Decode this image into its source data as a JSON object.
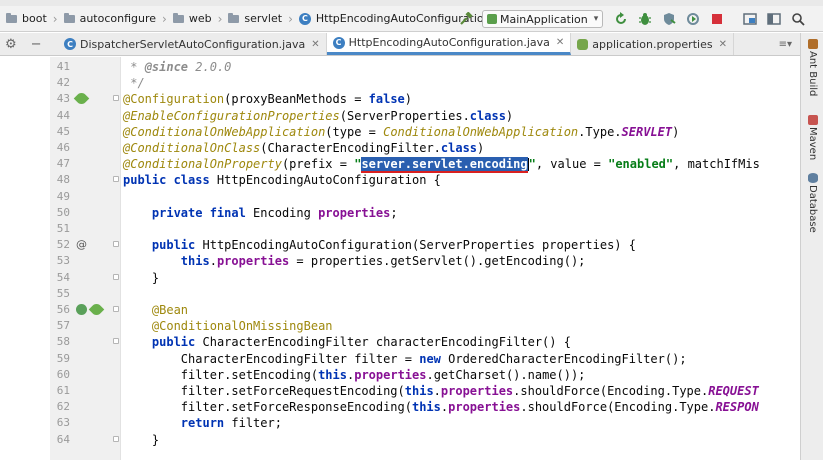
{
  "breadcrumbs": [
    "boot",
    "autoconfigure",
    "web",
    "servlet",
    "HttpEncodingAutoConfiguration"
  ],
  "run_config": "MainApplication",
  "tabs": [
    {
      "label": "DispatcherServletAutoConfiguration.java",
      "active": false,
      "icon": "class-icon"
    },
    {
      "label": "HttpEncodingAutoConfiguration.java",
      "active": true,
      "icon": "class-icon"
    },
    {
      "label": "application.properties",
      "active": false,
      "icon": "properties-icon"
    }
  ],
  "tab_menu_label": "≡",
  "right_tools": [
    "Ant Build",
    "Maven",
    "Database"
  ],
  "colors": {
    "keyword": "#0033b3",
    "annotation": "#9e880d",
    "string": "#067d17",
    "field": "#871094",
    "selection": "#2a5fb0",
    "accent": "#4a88c7"
  },
  "lines": [
    {
      "n": "41",
      "html": " <span class=\"cmt\">* </span><span class=\"doctag\">@since</span><span class=\"cmt\"> 2.0.0</span>",
      "marks": []
    },
    {
      "n": "42",
      "html": " <span class=\"cmt\">*/</span>",
      "marks": []
    },
    {
      "n": "43",
      "html": "<span class=\"ann\">@Configuration</span>(proxyBeanMethods = <span class=\"kw\">false</span>)",
      "marks": [
        "leaf"
      ]
    },
    {
      "n": "44",
      "html": "<span class=\"ann-it\">@EnableConfigurationProperties</span>(ServerProperties.<span class=\"kw\">class</span>)",
      "marks": []
    },
    {
      "n": "45",
      "html": "<span class=\"ann-it\">@ConditionalOnWebApplication</span>(type = <span class=\"ann-it\">ConditionalOnWebApplication</span>.Type.<span class=\"cst\">SERVLET</span>)",
      "marks": []
    },
    {
      "n": "46",
      "html": "<span class=\"ann-it\">@ConditionalOnClass</span>(CharacterEncodingFilter.<span class=\"kw\">class</span>)",
      "marks": []
    },
    {
      "n": "47",
      "html": "<span class=\"ann-it\">@ConditionalOnProperty</span>(prefix = <span class=\"str\">\"</span><span class=\"sel\">server.servlet.encoding</span><span class=\"caret\"></span><span class=\"str\">\"</span>, value = <span class=\"str\">\"enabled\"</span>, matchIfMis",
      "marks": []
    },
    {
      "n": "48",
      "html": "<span class=\"kw\">public class</span> HttpEncodingAutoConfiguration {",
      "marks": []
    },
    {
      "n": "49",
      "html": "",
      "marks": []
    },
    {
      "n": "50",
      "html": "    <span class=\"kw\">private final</span> Encoding <span class=\"fld\">properties</span>;",
      "marks": []
    },
    {
      "n": "51",
      "html": "",
      "marks": []
    },
    {
      "n": "52",
      "html": "    <span class=\"kw\">public</span> HttpEncodingAutoConfiguration(ServerProperties properties) {",
      "marks": [
        "at"
      ]
    },
    {
      "n": "53",
      "html": "        <span class=\"kw\">this</span>.<span class=\"fld\">properties</span> = properties.getServlet().getEncoding();",
      "marks": []
    },
    {
      "n": "54",
      "html": "    }",
      "marks": []
    },
    {
      "n": "55",
      "html": "",
      "marks": []
    },
    {
      "n": "56",
      "html": "    <span class=\"ann\">@Bean</span>",
      "marks": [
        "bean",
        "leaf"
      ]
    },
    {
      "n": "57",
      "html": "    <span class=\"ann\">@ConditionalOnMissingBean</span>",
      "marks": []
    },
    {
      "n": "58",
      "html": "    <span class=\"kw\">public</span> CharacterEncodingFilter characterEncodingFilter() {",
      "marks": []
    },
    {
      "n": "59",
      "html": "        CharacterEncodingFilter filter = <span class=\"kw\">new</span> OrderedCharacterEncodingFilter();",
      "marks": []
    },
    {
      "n": "60",
      "html": "        filter.setEncoding(<span class=\"kw\">this</span>.<span class=\"fld\">properties</span>.getCharset().name());",
      "marks": []
    },
    {
      "n": "61",
      "html": "        filter.setForceRequestEncoding(<span class=\"kw\">this</span>.<span class=\"fld\">properties</span>.shouldForce(Encoding.Type.<span class=\"cst\">REQUEST</span>",
      "marks": []
    },
    {
      "n": "62",
      "html": "        filter.setForceResponseEncoding(<span class=\"kw\">this</span>.<span class=\"fld\">properties</span>.shouldForce(Encoding.Type.<span class=\"cst\">RESPON</span>",
      "marks": []
    },
    {
      "n": "63",
      "html": "        <span class=\"kw\">return</span> filter;",
      "marks": []
    },
    {
      "n": "64",
      "html": "    }",
      "marks": []
    }
  ],
  "folds": [
    "43",
    "48",
    "52",
    "54",
    "56",
    "58",
    "64"
  ]
}
